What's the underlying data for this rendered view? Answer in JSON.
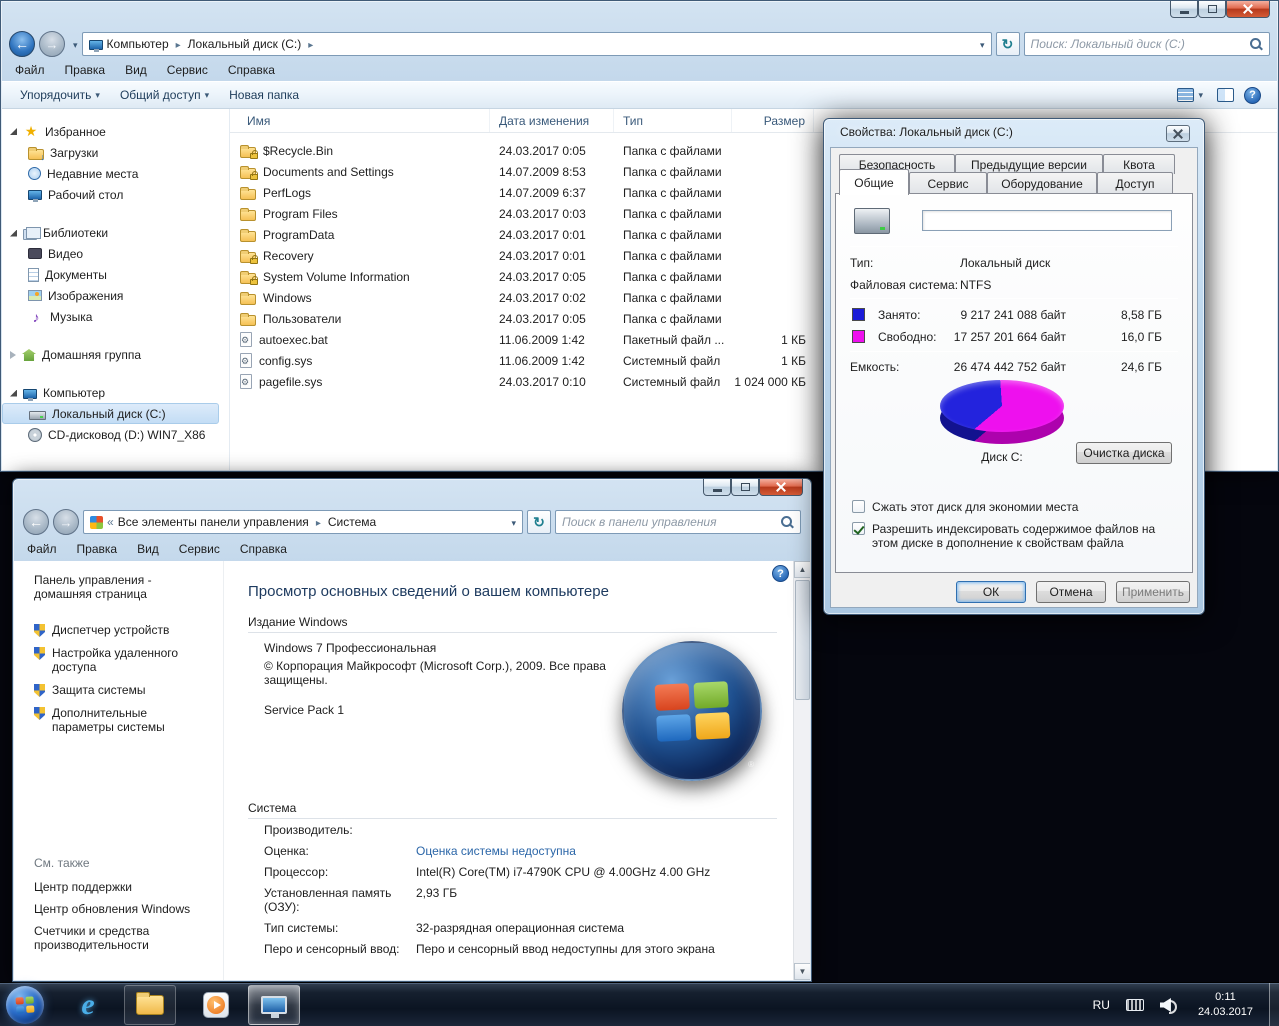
{
  "explorer": {
    "breadcrumb": [
      "Компьютер",
      "Локальный диск (C:)"
    ],
    "search_placeholder": "Поиск: Локальный диск (C:)",
    "menu": [
      "Файл",
      "Правка",
      "Вид",
      "Сервис",
      "Справка"
    ],
    "toolbar": {
      "organize": "Упорядочить",
      "share": "Общий доступ",
      "new_folder": "Новая папка"
    },
    "sidebar": {
      "favorites": {
        "label": "Избранное",
        "items": [
          "Загрузки",
          "Недавние места",
          "Рабочий стол"
        ]
      },
      "libraries": {
        "label": "Библиотеки",
        "items": [
          "Видео",
          "Документы",
          "Изображения",
          "Музыка"
        ]
      },
      "homegroup": {
        "label": "Домашняя группа"
      },
      "computer": {
        "label": "Компьютер",
        "items": [
          "Локальный диск (C:)",
          "CD-дисковод (D:) WIN7_X86"
        ]
      }
    },
    "columns": [
      "Имя",
      "Дата изменения",
      "Тип",
      "Размер"
    ],
    "files": [
      {
        "name": "$Recycle.Bin",
        "date": "24.03.2017 0:05",
        "type": "Папка с файлами",
        "size": ""
      },
      {
        "name": "Documents and Settings",
        "date": "14.07.2009 8:53",
        "type": "Папка с файлами",
        "size": ""
      },
      {
        "name": "PerfLogs",
        "date": "14.07.2009 6:37",
        "type": "Папка с файлами",
        "size": ""
      },
      {
        "name": "Program Files",
        "date": "24.03.2017 0:03",
        "type": "Папка с файлами",
        "size": ""
      },
      {
        "name": "ProgramData",
        "date": "24.03.2017 0:01",
        "type": "Папка с файлами",
        "size": ""
      },
      {
        "name": "Recovery",
        "date": "24.03.2017 0:01",
        "type": "Папка с файлами",
        "size": ""
      },
      {
        "name": "System Volume Information",
        "date": "24.03.2017 0:05",
        "type": "Папка с файлами",
        "size": ""
      },
      {
        "name": "Windows",
        "date": "24.03.2017 0:02",
        "type": "Папка с файлами",
        "size": ""
      },
      {
        "name": "Пользователи",
        "date": "24.03.2017 0:05",
        "type": "Папка с файлами",
        "size": ""
      },
      {
        "name": "autoexec.bat",
        "date": "11.06.2009 1:42",
        "type": "Пакетный файл ...",
        "size": "1 КБ"
      },
      {
        "name": "config.sys",
        "date": "11.06.2009 1:42",
        "type": "Системный файл",
        "size": "1 КБ"
      },
      {
        "name": "pagefile.sys",
        "date": "24.03.2017 0:10",
        "type": "Системный файл",
        "size": "1 024 000 КБ"
      }
    ]
  },
  "properties_dialog": {
    "title": "Свойства: Локальный диск (C:)",
    "back_tabs": [
      "Безопасность",
      "Предыдущие версии",
      "Квота"
    ],
    "front_tabs": [
      "Общие",
      "Сервис",
      "Оборудование",
      "Доступ"
    ],
    "active_tab": "Общие",
    "label_value": "",
    "rows": {
      "type_label": "Тип:",
      "type_value": "Локальный диск",
      "fs_label": "Файловая система:",
      "fs_value": "NTFS",
      "used_label": "Занято:",
      "used_bytes": "9 217 241 088 байт",
      "used_gb": "8,58 ГБ",
      "free_label": "Свободно:",
      "free_bytes": "17 257 201 664 байт",
      "free_gb": "16,0 ГБ",
      "capacity_label": "Емкость:",
      "capacity_bytes": "26 474 442 752 байт",
      "capacity_gb": "24,6 ГБ"
    },
    "pie": {
      "label": "Диск C:",
      "used_color": "#2323dd",
      "free_color": "#ee10ee",
      "used_percent": 35,
      "free_percent": 65
    },
    "cleanup_button": "Очистка диска",
    "compress_label": "Сжать этот диск для экономии места",
    "index_label": "Разрешить индексировать содержимое файлов на этом диске в дополнение к свойствам файла",
    "buttons": {
      "ok": "ОК",
      "cancel": "Отмена",
      "apply": "Применить"
    }
  },
  "system_window": {
    "breadcrumb": [
      "Все элементы панели управления",
      "Система"
    ],
    "search_placeholder": "Поиск в панели управления",
    "menu": [
      "Файл",
      "Правка",
      "Вид",
      "Сервис",
      "Справка"
    ],
    "sidebar": {
      "home": "Панель управления - домашняя страница",
      "tasks": [
        "Диспетчер устройств",
        "Настройка удаленного доступа",
        "Защита системы",
        "Дополнительные параметры системы"
      ],
      "see_also": "См. также",
      "links": [
        "Центр поддержки",
        "Центр обновления Windows",
        "Счетчики и средства производительности"
      ]
    },
    "heading": "Просмотр основных сведений о вашем компьютере",
    "edition_section": "Издание Windows",
    "edition_name": "Windows 7 Профессиональная",
    "copyright": "© Корпорация Майкрософт (Microsoft Corp.), 2009. Все права защищены.",
    "service_pack": "Service Pack 1",
    "system_section": "Система",
    "info_rows": [
      {
        "label": "Производитель:",
        "value": ""
      },
      {
        "label": "Оценка:",
        "value": "Оценка системы недоступна"
      },
      {
        "label": "Процессор:",
        "value": "Intel(R) Core(TM) i7-4790K CPU @ 4.00GHz  4.00 GHz"
      },
      {
        "label": "Установленная память (ОЗУ):",
        "value": "2,93 ГБ"
      },
      {
        "label": "Тип системы:",
        "value": "32-разрядная операционная система"
      },
      {
        "label": "Перо и сенсорный ввод:",
        "value": "Перо и сенсорный ввод недоступны для этого экрана"
      }
    ]
  },
  "taskbar": {
    "language": "RU",
    "time": "0:11",
    "date": "24.03.2017"
  }
}
